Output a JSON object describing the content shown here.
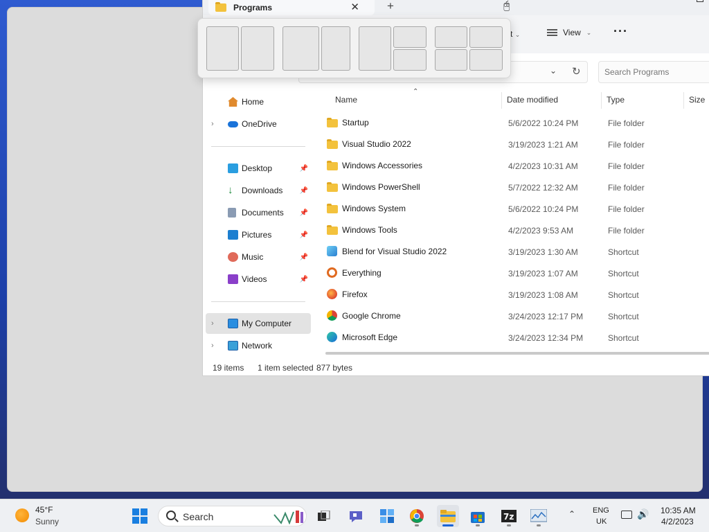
{
  "explorer": {
    "tab_title": "Programs",
    "tab_close_glyph": "✕",
    "new_tab_glyph": "+",
    "command_bar": {
      "sort_label": "rt",
      "view_label": "View",
      "more_glyph": "···"
    },
    "search_placeholder": "Search Programs",
    "nav": {
      "home": "Home",
      "onedrive": "OneDrive",
      "desktop": "Desktop",
      "downloads": "Downloads",
      "documents": "Documents",
      "pictures": "Pictures",
      "music": "Music",
      "videos": "Videos",
      "my_computer": "My Computer",
      "network": "Network"
    },
    "columns": {
      "name": "Name",
      "date": "Date modified",
      "type": "Type",
      "size": "Size"
    },
    "files": [
      {
        "name": "Startup",
        "date": "5/6/2022 10:24 PM",
        "type": "File folder",
        "icon": "folder-icon"
      },
      {
        "name": "Visual Studio 2022",
        "date": "3/19/2023 1:21 AM",
        "type": "File folder",
        "icon": "folder-icon"
      },
      {
        "name": "Windows Accessories",
        "date": "4/2/2023 10:31 AM",
        "type": "File folder",
        "icon": "folder-icon"
      },
      {
        "name": "Windows PowerShell",
        "date": "5/7/2022 12:32 AM",
        "type": "File folder",
        "icon": "folder-icon"
      },
      {
        "name": "Windows System",
        "date": "5/6/2022 10:24 PM",
        "type": "File folder",
        "icon": "folder-icon"
      },
      {
        "name": "Windows Tools",
        "date": "4/2/2023 9:53 AM",
        "type": "File folder",
        "icon": "folder-icon"
      },
      {
        "name": "Blend for Visual Studio 2022",
        "date": "3/19/2023 1:30 AM",
        "type": "Shortcut",
        "icon": "blend-icon"
      },
      {
        "name": "Everything",
        "date": "3/19/2023 1:07 AM",
        "type": "Shortcut",
        "icon": "everything-icon"
      },
      {
        "name": "Firefox",
        "date": "3/19/2023 1:08 AM",
        "type": "Shortcut",
        "icon": "firefox-icon"
      },
      {
        "name": "Google Chrome",
        "date": "3/24/2023 12:17 PM",
        "type": "Shortcut",
        "icon": "chrome-icon"
      },
      {
        "name": "Microsoft Edge",
        "date": "3/24/2023 12:34 PM",
        "type": "Shortcut",
        "icon": "edge-icon"
      }
    ],
    "status": {
      "items": "19 items",
      "selected": "1 item selected",
      "size": "877 bytes"
    }
  },
  "taskbar": {
    "weather": {
      "temp": "45°F",
      "condition": "Sunny"
    },
    "search_label": "Search",
    "lang_line1": "ENG",
    "lang_line2": "UK",
    "clock_time": "10:35 AM",
    "clock_date": "4/2/2023"
  },
  "colors": {
    "folder": "#f3c23d",
    "accent": "#1a64d8",
    "selection": "#e3e3e3"
  }
}
